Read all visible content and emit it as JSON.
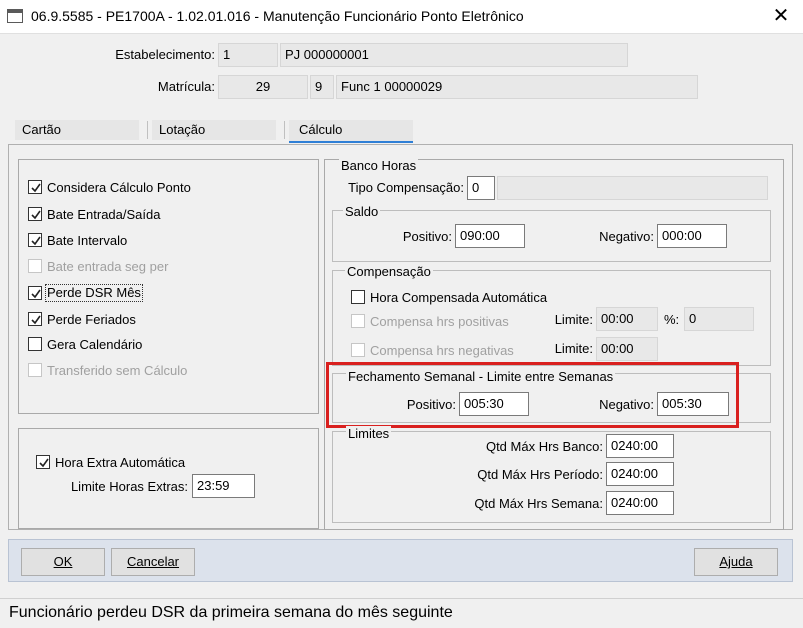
{
  "window": {
    "title": "06.9.5585 - PE1700A - 1.02.01.016 - Manutenção Funcionário Ponto Eletrônico",
    "close_glyph": "✕"
  },
  "header": {
    "estabelecimento_label": "Estabelecimento:",
    "estabelecimento_code": "1",
    "estabelecimento_name": "PJ 000000001",
    "matricula_label": "Matrícula:",
    "matricula_number": "29",
    "matricula_digit": "9",
    "matricula_name": "Func 1  00000029"
  },
  "tabs": [
    {
      "label": "Cartão"
    },
    {
      "label": "Lotação"
    },
    {
      "label": "Cálculo"
    }
  ],
  "calc_options": [
    {
      "label": "Considera Cálculo Ponto",
      "checked": true,
      "enabled": true
    },
    {
      "label": "Bate Entrada/Saída",
      "checked": true,
      "enabled": true
    },
    {
      "label": "Bate Intervalo",
      "checked": true,
      "enabled": true
    },
    {
      "label": "Bate entrada seg per",
      "checked": false,
      "enabled": false
    },
    {
      "label": "Perde DSR Mês",
      "checked": true,
      "enabled": true
    },
    {
      "label": "Perde Feriados",
      "checked": true,
      "enabled": true
    },
    {
      "label": "Gera Calendário",
      "checked": false,
      "enabled": true
    },
    {
      "label": "Transferido sem Cálculo",
      "checked": false,
      "enabled": false
    }
  ],
  "hora_extra": {
    "checkbox_label": "Hora Extra Automática",
    "checked": true,
    "limite_label": "Limite Horas Extras:",
    "limite_value": "23:59"
  },
  "banco_horas": {
    "title": "Banco Horas",
    "tipo_label": "Tipo Compensação:",
    "tipo_value": "0",
    "tipo_desc": "",
    "saldo": {
      "title": "Saldo",
      "positivo_label": "Positivo:",
      "positivo_value": "090:00",
      "negativo_label": "Negativo:",
      "negativo_value": "000:00"
    },
    "compensacao": {
      "title": "Compensação",
      "hora_auto_label": "Hora Compensada Automática",
      "hora_auto_checked": false,
      "positivas_label": "Compensa hrs positivas",
      "negativas_label": "Compensa hrs negativas",
      "limite_label": "Limite:",
      "limite_pos_value": "00:00",
      "pct_label": "%:",
      "pct_value": "0",
      "limite_neg_value": "00:00"
    },
    "fechamento": {
      "title": "Fechamento Semanal - Limite entre Semanas",
      "positivo_label": "Positivo:",
      "positivo_value": "005:30",
      "negativo_label": "Negativo:",
      "negativo_value": "005:30",
      "highlight_color": "#d9201f"
    }
  },
  "limites": {
    "title": "Limites",
    "banco_label": "Qtd Máx Hrs Banco:",
    "banco_value": "0240:00",
    "periodo_label": "Qtd Máx Hrs Período:",
    "periodo_value": "0240:00",
    "semana_label": "Qtd Máx Hrs Semana:",
    "semana_value": "0240:00"
  },
  "buttons": {
    "ok": "OK",
    "cancelar": "Cancelar",
    "ajuda": "Ajuda"
  },
  "status_text": "Funcionário perdeu DSR da primeira semana do mês seguinte",
  "colors": {
    "active_tab_underline": "#2f7fd6",
    "button_bar": "#dce2ec"
  }
}
